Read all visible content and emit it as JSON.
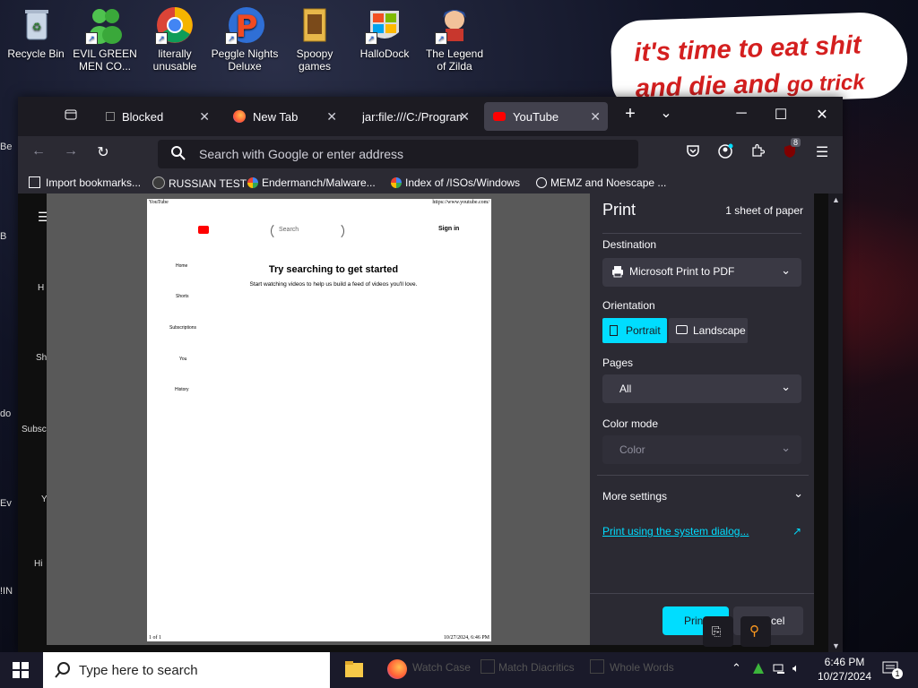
{
  "desktop": {
    "icons": [
      {
        "label": "Recycle Bin",
        "icon": "recycle-bin-icon",
        "color": "#9fb8d8"
      },
      {
        "label": "EVIL GREEN MEN CO...",
        "icon": "green-men-icon",
        "color": "#3bb53b"
      },
      {
        "label": "literally unusable",
        "icon": "chrome-icon",
        "color": "#e8453c"
      },
      {
        "label": "Peggle Nights Deluxe",
        "icon": "peggle-icon",
        "color": "#e94b2d"
      },
      {
        "label": "Spoopy games",
        "icon": "folder-icon",
        "color": "#e8b84a"
      },
      {
        "label": "HalloDock",
        "icon": "windows-logo-icon",
        "color": "#f25022"
      },
      {
        "label": "The Legend of Zilda",
        "icon": "zilda-icon",
        "color": "#2f5fa8"
      }
    ],
    "speech_line1": "it's time to eat shit",
    "speech_line2": "and die and",
    "speech_line2b": "go trick",
    "left_ghost": [
      "Be",
      "B",
      "do",
      "Ev",
      "!IN"
    ]
  },
  "browser": {
    "tabs": [
      {
        "label": "Blocked",
        "icon": "blocked-page-icon"
      },
      {
        "label": "New Tab",
        "icon": "firefox-icon"
      },
      {
        "label": "jar:file:///C:/Program",
        "icon": "file-icon"
      },
      {
        "label": "YouTube",
        "icon": "youtube-icon"
      }
    ],
    "search_placeholder": "Search with Google or enter address",
    "extension_badge": "8",
    "bookmarks": [
      {
        "label": "Import bookmarks...",
        "icon": "import-icon"
      },
      {
        "label": "RUSSIAN TEST",
        "icon": "site-icon"
      },
      {
        "label": "Endermanch/Malware...",
        "icon": "google-icon"
      },
      {
        "label": "Index of /ISOs/Windows",
        "icon": "google-icon"
      },
      {
        "label": "MEMZ and Noescape ...",
        "icon": "globe-icon"
      }
    ],
    "yt_side_labels": [
      "H",
      "Sh",
      "Subsc",
      "Y",
      "Hi"
    ]
  },
  "print_preview": {
    "header_left": "YouTube",
    "header_right": "https://www.youtube.com/",
    "search": "Search",
    "sign_in": "Sign in",
    "nav": [
      "Home",
      "Shorts",
      "Subscriptions",
      "You",
      "History"
    ],
    "headline": "Try searching to get started",
    "subtext": "Start watching videos to help us build a feed of videos you'll love.",
    "footer_left": "1 of 1",
    "footer_right": "10/27/2024, 6:46 PM"
  },
  "print_panel": {
    "title": "Print",
    "sheets": "1 sheet of paper",
    "destination_label": "Destination",
    "destination_value": "Microsoft Print to PDF",
    "orientation_label": "Orientation",
    "portrait": "Portrait",
    "landscape": "Landscape",
    "pages_label": "Pages",
    "pages_value": "All",
    "color_label": "Color mode",
    "color_value": "Color",
    "more_settings": "More settings",
    "system_dialog": "Print using the system dialog...",
    "print_button": "Print",
    "cancel_button": "Cancel",
    "accent": "#00ddff"
  },
  "taskbar": {
    "search_placeholder": "Type here to search",
    "find_bar": [
      "Match Case",
      "Match Diacritics",
      "Whole Words"
    ],
    "find_prefix": "Watch Case",
    "time": "6:46 PM",
    "date": "10/27/2024",
    "notification_count": "1"
  }
}
